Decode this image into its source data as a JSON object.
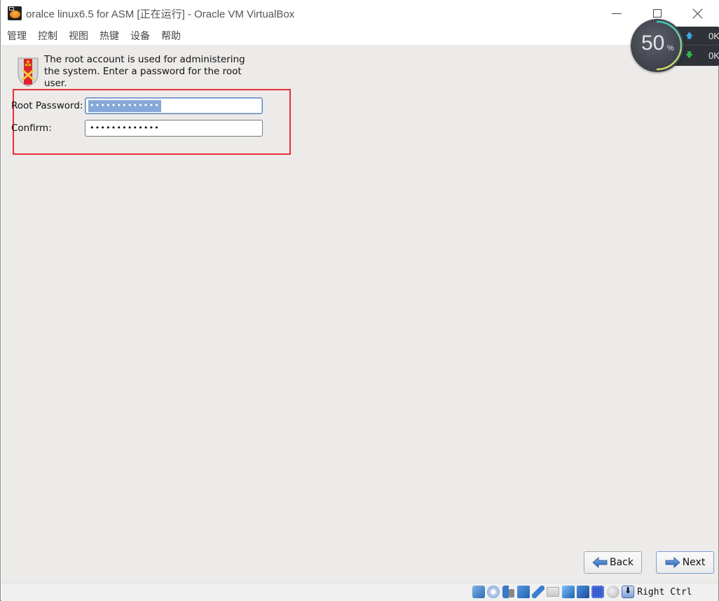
{
  "window": {
    "title": "oralce linux6.5 for ASM [正在运行] - Oracle VM VirtualBox",
    "controls": {
      "minimize": "minimize",
      "maximize": "maximize",
      "close": "close"
    }
  },
  "menubar": {
    "items": [
      {
        "label": "管理"
      },
      {
        "label": "控制"
      },
      {
        "label": "视图"
      },
      {
        "label": "热键"
      },
      {
        "label": "设备"
      },
      {
        "label": "帮助"
      }
    ]
  },
  "installer": {
    "description": "The root account is used for administering the system.  Enter a password for the root user.",
    "root_password_label": "Root Password:",
    "root_password_value": "•••••••••••••",
    "confirm_label": "Confirm:",
    "confirm_value": "•••••••••••••",
    "back_label": "Back",
    "next_label": "Next",
    "highlight_color": "#e8303a"
  },
  "statusbar": {
    "icons": [
      "hard-disk-icon",
      "optical-drive-icon",
      "audio-icon",
      "network-icon",
      "usb-icon",
      "shared-folder-icon",
      "display-icon",
      "recording-icon",
      "cpu-icon",
      "mouse-integration-icon",
      "keyboard-icon"
    ],
    "host_key": "Right Ctrl"
  },
  "perf_widget": {
    "percent_value": "50",
    "percent_unit": "%",
    "upload": "0K",
    "download": "0K",
    "gauge_fraction": 0.5
  }
}
